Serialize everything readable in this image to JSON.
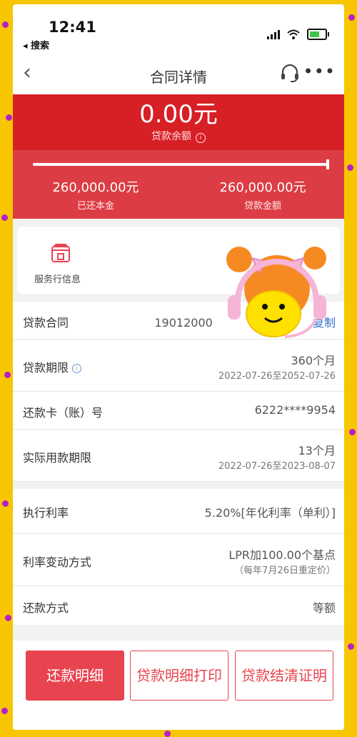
{
  "status_bar": {
    "time": "12:41",
    "back_app": "◂ 搜索"
  },
  "nav": {
    "title": "合同详情",
    "back_icon": "chevron-left-icon",
    "service_icon": "headset-icon",
    "more_icon": "more-icon"
  },
  "loan": {
    "balance": "0.00元",
    "balance_label": "贷款余额",
    "repaid_amount": "260,000.00元",
    "repaid_label": "已还本金",
    "loan_amount": "260,000.00元",
    "loan_label": "贷款金额",
    "repaid_progress": 1.0
  },
  "service": {
    "label": "服务行信息",
    "icon": "shop-icon"
  },
  "details": {
    "contract": {
      "label": "贷款合同",
      "value": "19012000",
      "action": "复制"
    },
    "term": {
      "label": "贷款期限",
      "value": "360个月",
      "range": "2022-07-26至2052-07-26"
    },
    "card": {
      "label": "还款卡（账）号",
      "value": "6222****9954"
    },
    "actual_term": {
      "label": "实际用款期限",
      "value": "13个月",
      "range": "2022-07-26至2023-08-07"
    },
    "rate": {
      "label": "执行利率",
      "value": "5.20%[年化利率（单利）]"
    },
    "rate_change": {
      "label": "利率变动方式",
      "value": "LPR加100.00个基点",
      "note": "（每年7月26日重定价）"
    },
    "repay_method": {
      "label": "还款方式",
      "value": "等额"
    }
  },
  "buttons": {
    "repay_detail": "还款明细",
    "print_detail": "贷款明细打印",
    "settle_cert": "贷款结清证明"
  },
  "colors": {
    "red": "#d71f26",
    "accent": "#e8444f",
    "link": "#2f6fd1"
  }
}
